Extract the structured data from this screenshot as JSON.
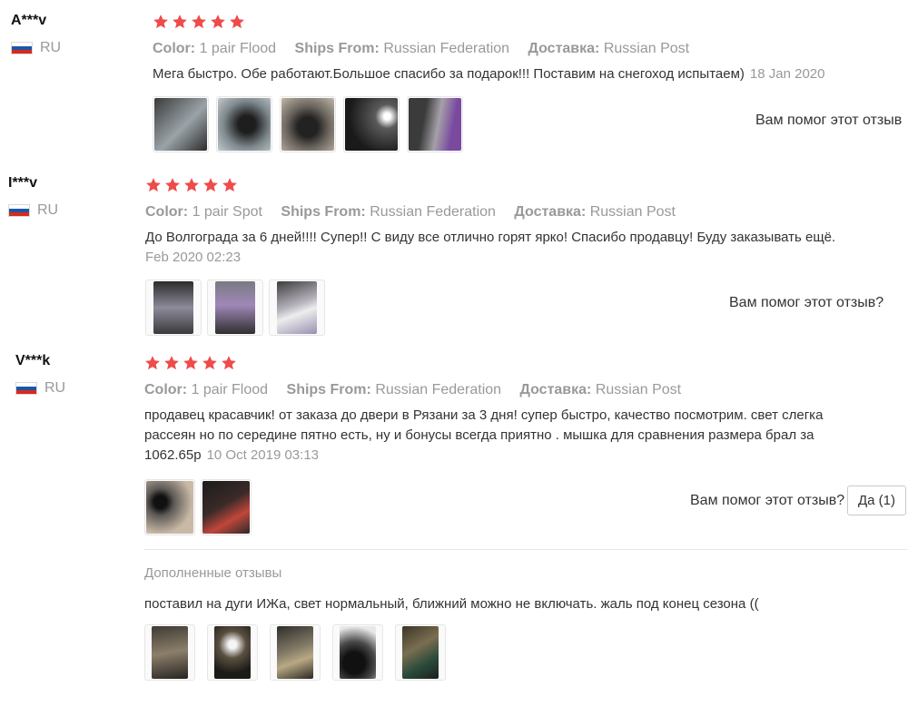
{
  "labels": {
    "color": "Color:",
    "ships_from": "Ships From:",
    "delivery": "Доставка:",
    "helpful": "Вам помог этот отзыв?",
    "additional_reviews": "Дополненные отзывы"
  },
  "colors": {
    "star": "#ef4b4b",
    "muted": "#999999",
    "text": "#333333"
  },
  "reviews": [
    {
      "user": "A***v",
      "country": "RU",
      "rating": 5,
      "color": "1 pair Flood",
      "ships_from": "Russian Federation",
      "delivery": "Russian Post",
      "text": "Мега быстро. Обе работают.Большое спасибо за подарок!!! Поставим на снегоход испытаем)",
      "date": "18 Jan 2020",
      "photos": [
        "photo-lights-packed",
        "photo-light-mount",
        "photo-light-on-snow",
        "photo-dark-lamp",
        "photo-lamp-beam"
      ],
      "helpful": "Вам помог этот отзыв"
    },
    {
      "user": "I***v",
      "country": "RU",
      "rating": 5,
      "color": "1 pair Spot",
      "ships_from": "Russian Federation",
      "delivery": "Russian Post",
      "text": "До Волгограда за 6 дней!!!! Супер!! С виду все отлично горят ярко! Спасибо продавцу! Буду заказывать ещё.",
      "date": "Feb 2020 02:23",
      "photos": [
        "photo-two-lights",
        "photo-light-hand",
        "photo-box"
      ],
      "helpful": "Вам помог этот отзыв?"
    },
    {
      "user": "V***k",
      "country": "RU",
      "rating": 5,
      "color": "1 pair Flood",
      "ships_from": "Russian Federation",
      "delivery": "Russian Post",
      "text": "продавец красавчик! от заказа до двери в Рязани за 3 дня! супер быстро, качество посмотрим. свет слегка рассеян но по середине пятно есть, ну и бонусы всегда приятно . мышка для сравнения размера брал за 1062.65р",
      "date": "10 Oct 2019 03:13",
      "photos": [
        "photo-lights-and-mouse",
        "photo-wired-light"
      ],
      "helpful": "Вам помог этот отзыв?",
      "yes_button": "Да (1)",
      "additional": {
        "text": "поставил на дуги ИЖа, свет нормальный, ближний можно не включать. жаль под конец сезона ((",
        "photos": [
          "photo-mounted-1",
          "photo-mounted-2",
          "photo-mounted-3",
          "photo-bike-night",
          "photo-garage"
        ]
      }
    }
  ]
}
